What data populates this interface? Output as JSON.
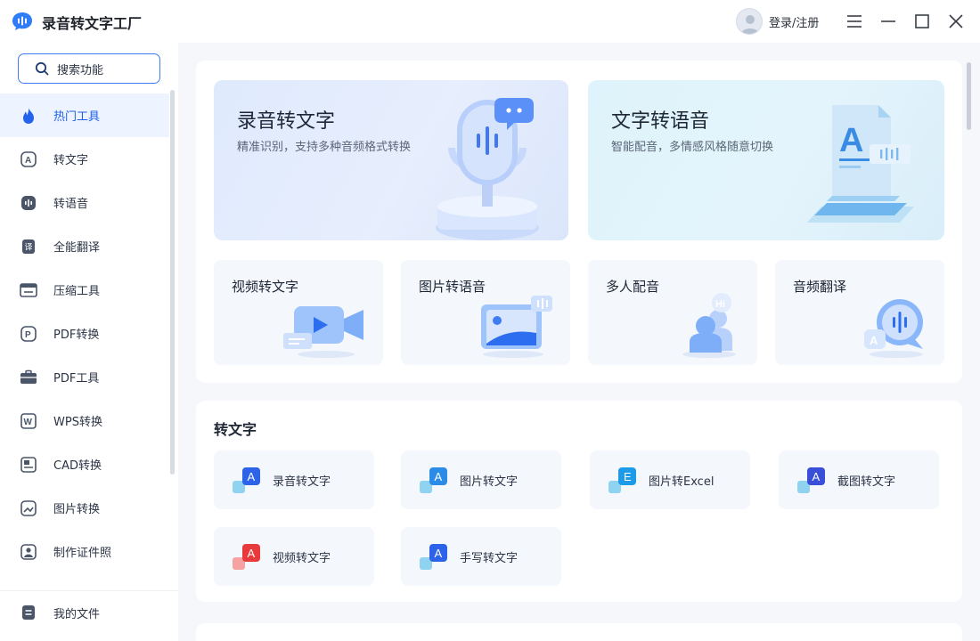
{
  "app": {
    "title": "录音转文字工厂"
  },
  "header": {
    "login_label": "登录/注册"
  },
  "search": {
    "label": "搜索功能"
  },
  "sidebar": {
    "items": [
      {
        "label": "热门工具",
        "icon": "fire-icon"
      },
      {
        "label": "转文字",
        "icon": "text-convert-icon"
      },
      {
        "label": "转语音",
        "icon": "voice-convert-icon"
      },
      {
        "label": "全能翻译",
        "icon": "translate-icon"
      },
      {
        "label": "压缩工具",
        "icon": "compress-icon"
      },
      {
        "label": "PDF转换",
        "icon": "pdf-convert-icon"
      },
      {
        "label": "PDF工具",
        "icon": "pdf-tools-icon"
      },
      {
        "label": "WPS转换",
        "icon": "wps-icon"
      },
      {
        "label": "CAD转换",
        "icon": "cad-icon"
      },
      {
        "label": "图片转换",
        "icon": "image-convert-icon"
      },
      {
        "label": "制作证件照",
        "icon": "id-photo-icon"
      }
    ],
    "bottom": {
      "label": "我的文件",
      "icon": "file-icon"
    }
  },
  "hero": [
    {
      "title": "录音转文字",
      "subtitle": "精准识别，支持多种音频格式转换"
    },
    {
      "title": "文字转语音",
      "subtitle": "智能配音，多情感风格随意切换"
    }
  ],
  "cards": [
    {
      "title": "视频转文字"
    },
    {
      "title": "图片转语音"
    },
    {
      "title": "多人配音"
    },
    {
      "title": "音频翻译"
    }
  ],
  "section1": {
    "title": "转文字",
    "tools": [
      {
        "label": "录音转文字",
        "glyph": "A",
        "color": "#2d63e8"
      },
      {
        "label": "图片转文字",
        "glyph": "A",
        "color": "#2d8be8"
      },
      {
        "label": "图片转Excel",
        "glyph": "E",
        "color": "#1e9be8"
      },
      {
        "label": "截图转文字",
        "glyph": "A",
        "color": "#3a4fd8"
      },
      {
        "label": "视频转文字",
        "glyph": "A",
        "color": "#e83a3a"
      },
      {
        "label": "手写转文字",
        "glyph": "A",
        "color": "#2d63e8"
      }
    ]
  },
  "theme": {
    "accent": "#3d7cf5",
    "active_bg": "#eef4ff"
  }
}
